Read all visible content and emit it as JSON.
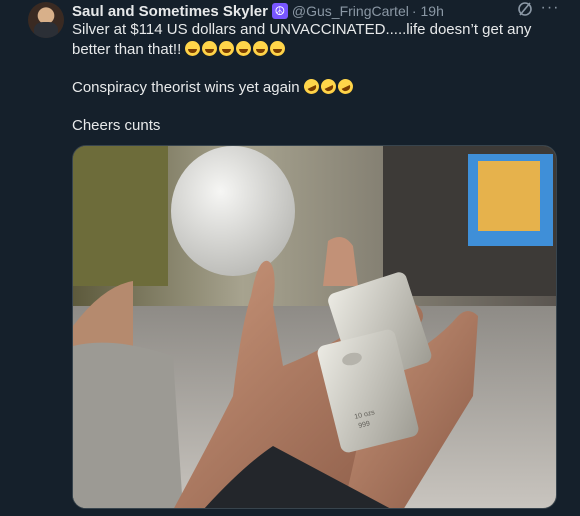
{
  "tweet": {
    "author_name": "Saul and Sometimes Skyler",
    "badge_icon": "peace-sign-icon",
    "handle": "@Gus_FringCartel",
    "separator": "·",
    "time": "19h",
    "line1": "Silver at $114 US dollars and UNVACCINATED.....life doesn’t get any better than that!!",
    "line1_emoji_count": 6,
    "line2": "Conspiracy theorist wins yet again",
    "line2_emoji_count": 3,
    "line3": "Cheers cunts"
  },
  "media": {
    "bar_stamp_a": "10 ozs",
    "bar_stamp_b": "999"
  },
  "icons": {
    "grok": "grok-icon",
    "more": "more-options-icon"
  },
  "colors": {
    "background": "#15202b",
    "text": "#e7e9ea",
    "secondary_text": "#8b98a5",
    "badge": "#7856ff"
  }
}
